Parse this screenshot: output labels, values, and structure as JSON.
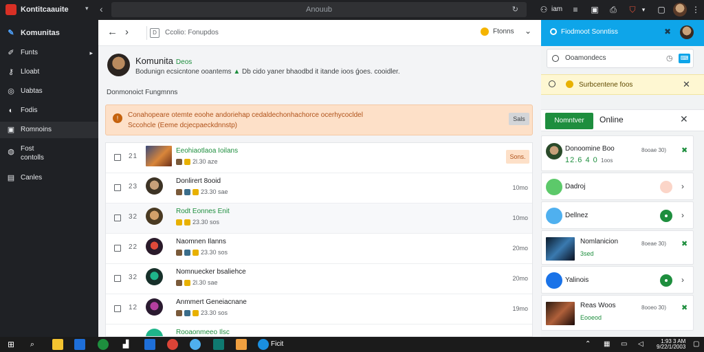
{
  "topbar": {
    "app_name": "Kontitcaauite",
    "address": "Anouub",
    "user_label": "iam"
  },
  "sidebar": {
    "items": [
      {
        "label": "Komunitas",
        "icon": "feather-icon"
      },
      {
        "label": "Funts",
        "icon": "wrench-icon"
      },
      {
        "label": "Lloabt",
        "icon": "key-icon"
      },
      {
        "label": "Uabtas",
        "icon": "globe-icon"
      },
      {
        "label": "Fodis",
        "icon": "chat-icon"
      },
      {
        "label": "Romnoins",
        "icon": "image-icon"
      },
      {
        "label": "Fost",
        "icon": "bulb-icon"
      },
      {
        "label": "contolls",
        "icon": ""
      },
      {
        "label": "Canles",
        "icon": "list-icon"
      }
    ]
  },
  "main": {
    "breadcrumb": "Ccolio: Fonupdos",
    "user_menu": "Ftonns",
    "profile": {
      "name": "Komunita",
      "tag": "Deos",
      "desc_a": "Bodunign ecsicntone ooantems",
      "desc_b": "Db cido yaner bhaodbd it itande ioos ǵoes. cooidler."
    },
    "section_title": "Donmonoict Fungmnns",
    "alert": {
      "line1": "Conahopeare otemte eoohe andoriehap cedaldechonhachorce ocerhycocldel",
      "line2": "Sccohcle (Eeme dcjecpaeckdnnstp)",
      "button": "Sals"
    },
    "rows": [
      {
        "num": "21",
        "title": "Eeohiaotlaoa Ioilans",
        "meta": "2l.30 aze",
        "time": "",
        "pill": "Sons."
      },
      {
        "num": "23",
        "title": "Donlirert 8ooid",
        "meta": "23.30 sae",
        "time": "10mo",
        "pill": ""
      },
      {
        "num": "32",
        "title": "Rodt Eonnes Enit",
        "meta": "23.30 sos",
        "time": "10mo",
        "pill": ""
      },
      {
        "num": "22",
        "title": "Naomnen Ilanns",
        "meta": "23.30 sos",
        "time": "20mo",
        "pill": ""
      },
      {
        "num": "32",
        "title": "Nomnuecker bsaliehce",
        "meta": "2l.30 sae",
        "time": "20mo",
        "pill": ""
      },
      {
        "num": "12",
        "title": "Anmmert Geneiacnane",
        "meta": "23.30 sos",
        "time": "19mo",
        "pill": ""
      },
      {
        "num": "",
        "title": "Rooaonmeeo Ilsc",
        "meta": "",
        "time": "",
        "pill": ""
      }
    ]
  },
  "right_panel": {
    "header": "Fiodmoot Sonntiss",
    "search": "Ooamondecs",
    "notice": "Surbcentene foos",
    "btn": "Nomntver",
    "online": "Online",
    "items": [
      {
        "title": "Donoomine Boo",
        "sub": "12.6 4 0",
        "sub2": "1oos",
        "time": "8ooae 30)"
      },
      {
        "title": "Dadroj",
        "sub": "",
        "sub2": "",
        "time": ""
      },
      {
        "title": "Dellnez",
        "sub": "",
        "sub2": "",
        "time": ""
      },
      {
        "title": "Nomlanicion",
        "sub": "3sed",
        "sub2": "",
        "time": "8oeae 30)"
      },
      {
        "title": "Yalinois",
        "sub": "",
        "sub2": "",
        "time": ""
      },
      {
        "title": "Reas Woos",
        "sub": "Eooeod",
        "sub2": "",
        "time": "8ooeo 30)"
      }
    ]
  },
  "taskbar": {
    "app_label": "Ficit",
    "clock_top": "1:93 3 AM",
    "clock_bottom": "9/22/1/2003"
  }
}
